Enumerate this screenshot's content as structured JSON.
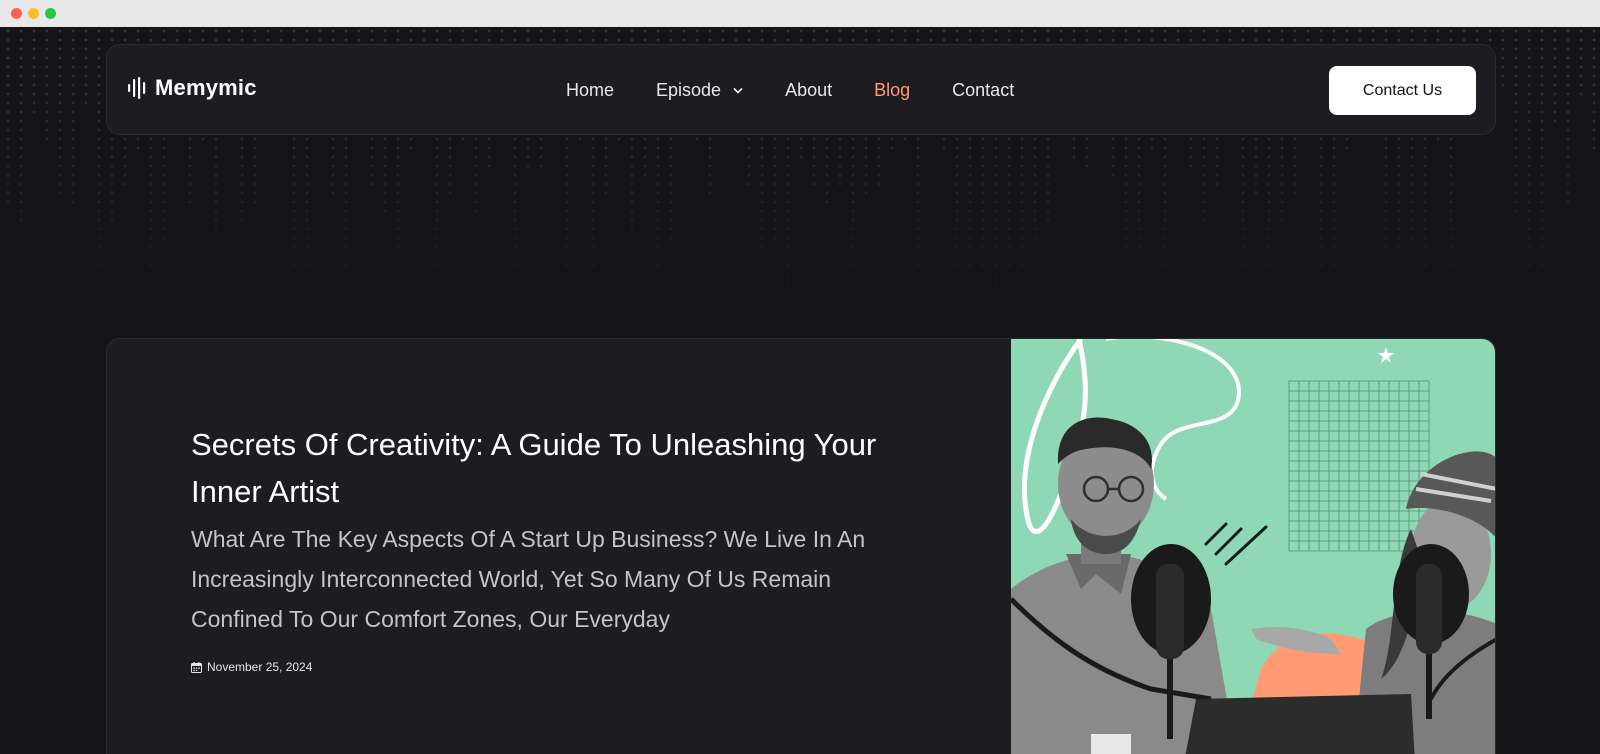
{
  "brand": {
    "name": "Memymic",
    "icon": "soundwave-icon"
  },
  "nav": {
    "items": [
      {
        "label": "Home"
      },
      {
        "label": "Episode",
        "icon": "chevron-down-icon"
      },
      {
        "label": "About"
      },
      {
        "label": "Blog",
        "active": true
      },
      {
        "label": "Contact"
      }
    ],
    "cta_label": "Contact Us"
  },
  "post": {
    "title": "Secrets Of Creativity: A Guide To Unleashing Your Inner Artist",
    "excerpt": "What Are The Key Aspects Of A Start Up Business? We Live In An Increasingly Interconnected World, Yet So Many Of Us Remain Confined To Our Comfort Zones, Our Everyday",
    "date": "November 25, 2024",
    "date_icon": "calendar-icon",
    "image": "podcast-hosts-photo"
  },
  "colors": {
    "background": "#151518",
    "surface": "#1d1c21",
    "accent": "#ff9a73",
    "hero_green": "#8fd8b5"
  }
}
